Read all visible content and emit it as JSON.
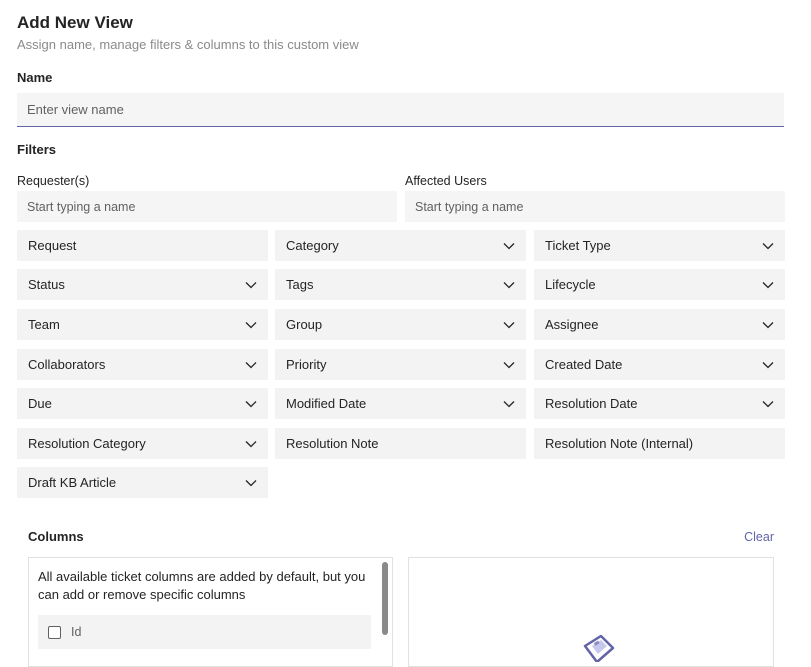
{
  "header": {
    "title": "Add New View",
    "subtitle": "Assign name, manage filters & columns to this custom view"
  },
  "name_section": {
    "label": "Name",
    "placeholder": "Enter view name"
  },
  "filters_section": {
    "label": "Filters",
    "requester": {
      "label": "Requester(s)",
      "placeholder": "Start typing a name"
    },
    "affected_users": {
      "label": "Affected Users",
      "placeholder": "Start typing a name"
    },
    "fields": [
      {
        "label": "Request",
        "dropdown": false
      },
      {
        "label": "Category",
        "dropdown": true
      },
      {
        "label": "Ticket Type",
        "dropdown": true
      },
      {
        "label": "Status",
        "dropdown": true
      },
      {
        "label": "Tags",
        "dropdown": true
      },
      {
        "label": "Lifecycle",
        "dropdown": true
      },
      {
        "label": "Team",
        "dropdown": true
      },
      {
        "label": "Group",
        "dropdown": true
      },
      {
        "label": "Assignee",
        "dropdown": true
      },
      {
        "label": "Collaborators",
        "dropdown": true
      },
      {
        "label": "Priority",
        "dropdown": true
      },
      {
        "label": "Created Date",
        "dropdown": true
      },
      {
        "label": "Due",
        "dropdown": true
      },
      {
        "label": "Modified Date",
        "dropdown": true
      },
      {
        "label": "Resolution Date",
        "dropdown": true
      },
      {
        "label": "Resolution Category",
        "dropdown": true
      },
      {
        "label": "Resolution Note",
        "dropdown": false
      },
      {
        "label": "Resolution Note (Internal)",
        "dropdown": false
      },
      {
        "label": "Draft KB Article",
        "dropdown": true
      }
    ]
  },
  "columns_section": {
    "title": "Columns",
    "clear_label": "Clear",
    "description": "All available ticket columns are added by default, but you can add or remove specific columns",
    "items": [
      {
        "label": "Id",
        "checked": false
      }
    ]
  },
  "colors": {
    "accent": "#6264a7",
    "field_bg": "#f3f3f3",
    "text": "#242424",
    "muted": "#8a8a8a"
  }
}
